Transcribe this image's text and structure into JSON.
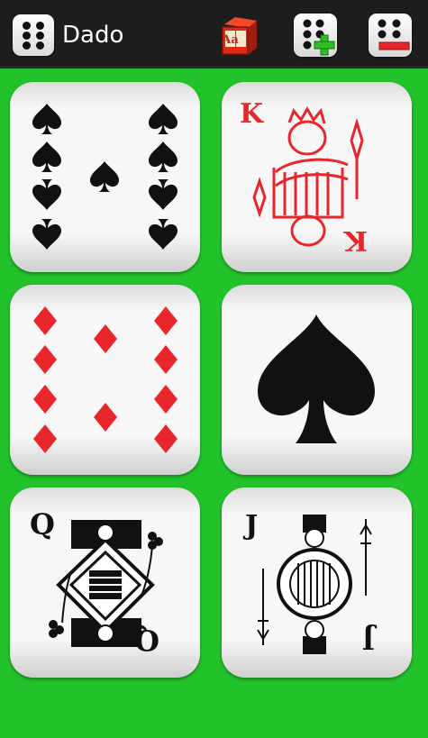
{
  "app": {
    "title": "Dado",
    "icon": "dice-six-icon"
  },
  "actions": [
    {
      "name": "letters-die-icon",
      "label": "Aa"
    },
    {
      "name": "add-die-icon"
    },
    {
      "name": "remove-die-icon"
    }
  ],
  "cards": [
    {
      "rank": "9",
      "suit": "spades"
    },
    {
      "rank": "K",
      "suit": "hearts"
    },
    {
      "rank": "10",
      "suit": "diamonds"
    },
    {
      "rank": "A",
      "suit": "spades"
    },
    {
      "rank": "Q",
      "suit": "clubs"
    },
    {
      "rank": "J",
      "suit": "spades"
    }
  ],
  "colors": {
    "background": "#22c22a",
    "topbar": "#1d1d1d",
    "red": "#e8262b",
    "black": "#111111"
  }
}
